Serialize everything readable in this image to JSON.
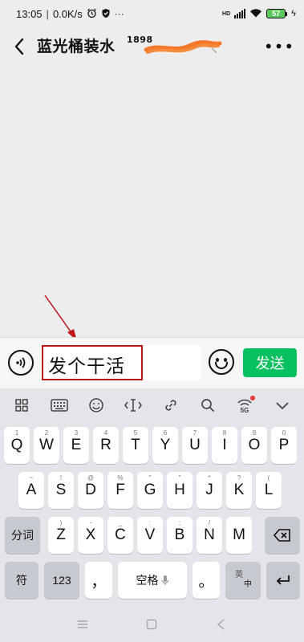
{
  "status_bar": {
    "time": "13:05",
    "speed": "0.0K/s",
    "network_label": "HD",
    "battery_level": "57",
    "icons": [
      "alarm-icon",
      "vpn-shield-icon",
      "more-dots-icon",
      "signal-icon",
      "wifi-icon",
      "battery-icon",
      "charging-icon"
    ]
  },
  "header": {
    "title": "蓝光桶装水",
    "phone_prefix": "1898",
    "back_icon": "chevron-left-icon",
    "more_icon": "more-horizontal-icon"
  },
  "composer": {
    "input_value": "发个干活",
    "send_label": "发送",
    "voice_icon": "voice-icon",
    "emoji_icon": "emoji-icon"
  },
  "keyboard": {
    "toolbar_icons": [
      "grid-icon",
      "keyboard-icon",
      "emoji-face-icon",
      "cursor-icon",
      "link-icon",
      "search-icon",
      "5g-icon",
      "chevron-down-icon"
    ],
    "toolbar_5g_label": "5G",
    "row1": [
      {
        "k": "Q",
        "h": "1"
      },
      {
        "k": "W",
        "h": "2"
      },
      {
        "k": "E",
        "h": "3"
      },
      {
        "k": "R",
        "h": "4"
      },
      {
        "k": "T",
        "h": "5"
      },
      {
        "k": "Y",
        "h": "6"
      },
      {
        "k": "U",
        "h": "7"
      },
      {
        "k": "I",
        "h": "8"
      },
      {
        "k": "O",
        "h": "9"
      },
      {
        "k": "P",
        "h": "0"
      }
    ],
    "row2": [
      {
        "k": "A",
        "h": "~"
      },
      {
        "k": "S",
        "h": "!"
      },
      {
        "k": "D",
        "h": "@"
      },
      {
        "k": "F",
        "h": "%"
      },
      {
        "k": "G",
        "h": "\""
      },
      {
        "k": "H",
        "h": "\""
      },
      {
        "k": "J",
        "h": "*"
      },
      {
        "k": "K",
        "h": "?"
      },
      {
        "k": "L",
        "h": "("
      }
    ],
    "row3": [
      {
        "k": "Z",
        "h": ")"
      },
      {
        "k": "X",
        "h": "-"
      },
      {
        "k": "C",
        "h": "_"
      },
      {
        "k": "V",
        "h": ":"
      },
      {
        "k": "B",
        "h": ";"
      },
      {
        "k": "N",
        "h": "/"
      },
      {
        "k": "M",
        "h": ""
      }
    ],
    "seg_label": "分词",
    "symbol_label": "符",
    "num_label": "123",
    "comma_label": "，",
    "space_label": "空格",
    "period_label": "。",
    "lang_top": "英",
    "lang_bottom": "中",
    "backspace_icon": "backspace-icon",
    "enter_icon": "enter-icon",
    "mic_icon": "mic-icon"
  },
  "nav_bar": {
    "icons": [
      "menu-icon",
      "home-icon",
      "back-icon"
    ]
  }
}
